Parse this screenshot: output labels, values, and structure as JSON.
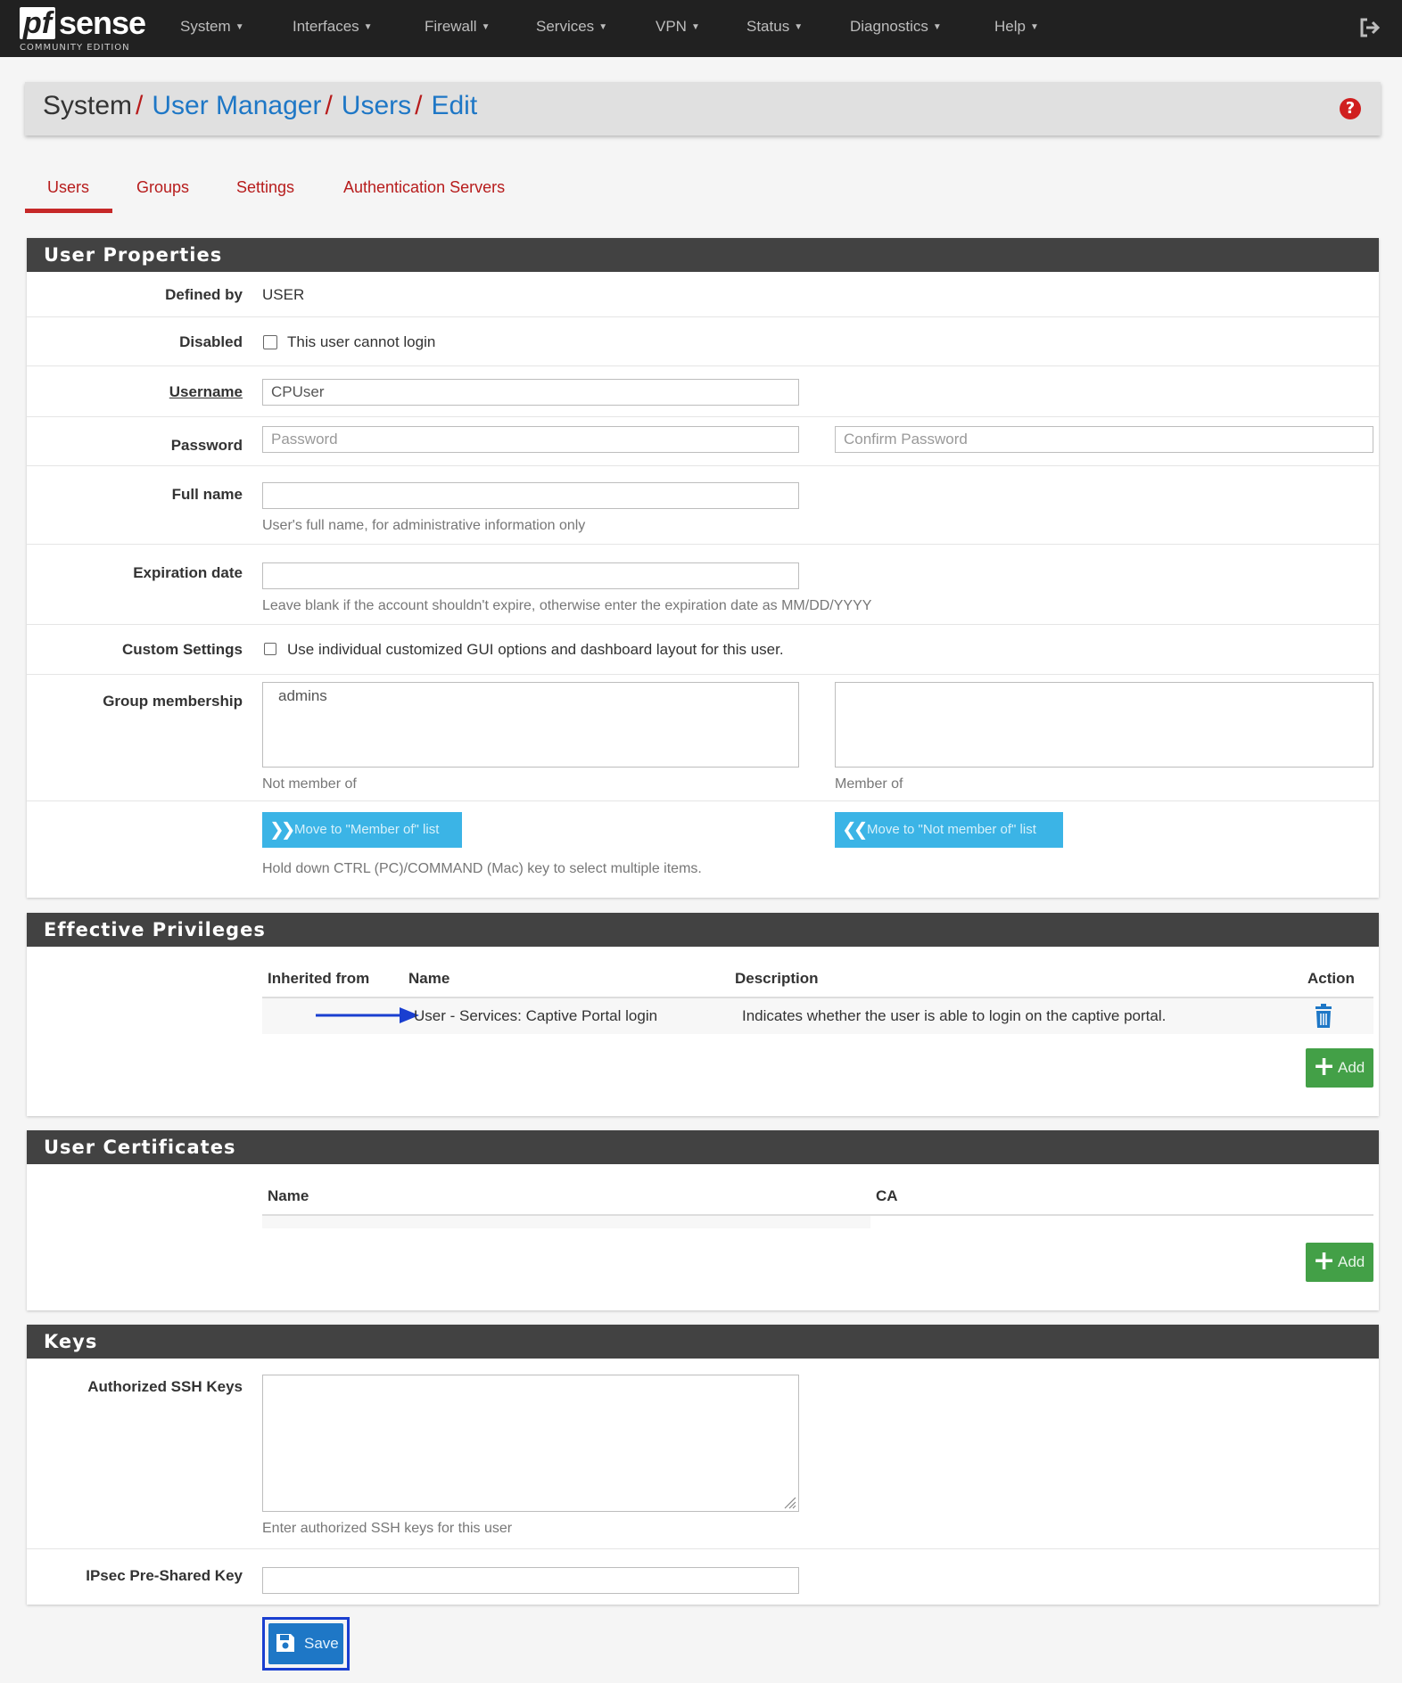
{
  "nav": {
    "brand": "sense",
    "brand_mark": "pf",
    "brand_sub": "COMMUNITY EDITION",
    "items": [
      "System",
      "Interfaces",
      "Firewall",
      "Services",
      "VPN",
      "Status",
      "Diagnostics",
      "Help"
    ]
  },
  "breadcrumb": {
    "root": "System",
    "links": [
      "User Manager",
      "Users",
      "Edit"
    ],
    "separator": "/"
  },
  "tabs": [
    "Users",
    "Groups",
    "Settings",
    "Authentication Servers"
  ],
  "active_tab": "Users",
  "user_properties": {
    "title": "User Properties",
    "defined_by_label": "Defined by",
    "defined_by_value": "USER",
    "disabled_label": "Disabled",
    "disabled_text": "This user cannot login",
    "username_label": "Username",
    "username_value": "CPUser",
    "password_label": "Password",
    "password_placeholder": "Password",
    "confirm_placeholder": "Confirm Password",
    "fullname_label": "Full name",
    "fullname_help": "User's full name, for administrative information only",
    "expiration_label": "Expiration date",
    "expiration_help": "Leave blank if the account shouldn't expire, otherwise enter the expiration date as MM/DD/YYYY",
    "custom_label": "Custom Settings",
    "custom_text": "Use individual customized GUI options and dashboard layout for this user.",
    "group_label": "Group membership",
    "not_member_options": [
      "admins"
    ],
    "not_member_caption": "Not member of",
    "member_caption": "Member of",
    "move_to_member": "Move to \"Member of\" list",
    "move_to_not_member": "Move to \"Not member of\" list",
    "multi_select_help": "Hold down CTRL (PC)/COMMAND (Mac) key to select multiple items."
  },
  "effective_privileges": {
    "title": "Effective Privileges",
    "columns": [
      "Inherited from",
      "Name",
      "Description",
      "Action"
    ],
    "rows": [
      {
        "inherited": "",
        "name": "User - Services: Captive Portal login",
        "description": "Indicates whether the user is able to login on the captive portal."
      }
    ],
    "add_label": "Add"
  },
  "user_certificates": {
    "title": "User Certificates",
    "columns": [
      "Name",
      "CA"
    ],
    "add_label": "Add"
  },
  "keys": {
    "title": "Keys",
    "ssh_label": "Authorized SSH Keys",
    "ssh_help": "Enter authorized SSH keys for this user",
    "ipsec_label": "IPsec Pre-Shared Key"
  },
  "save_label": "Save",
  "colors": {
    "navbar": "#212121",
    "link": "#1e77c6",
    "tab": "#b71c1c",
    "panel_head": "#424242",
    "info_button": "#3bb4e6",
    "success_button": "#43a047",
    "annotation_arrow": "#1a3fd0"
  }
}
